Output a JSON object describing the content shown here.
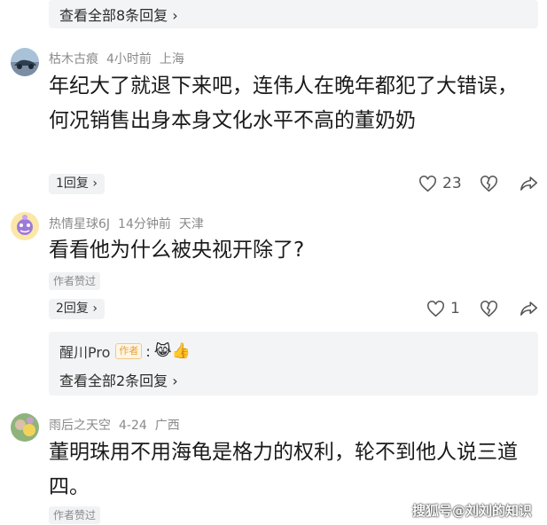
{
  "top_box": {
    "link": "查看全部8条回复 ›"
  },
  "comment1": {
    "user": "枯木古痕",
    "time": "4小时前",
    "location": "上海",
    "text": "年纪大了就退下来吧，连伟人在晚年都犯了大错误，何况销售出身本身文化水平不高的董奶奶",
    "reply_pill": "1回复 ›",
    "likes": "23"
  },
  "comment2": {
    "user": "热情星球6J",
    "time": "14分钟前",
    "location": "天津",
    "text": "看看他为什么被央视开除了?",
    "author_liked": "作者赞过",
    "reply_pill": "2回复 ›",
    "likes": "1",
    "sub_reply": {
      "user": "醒川Pro",
      "badge": "作者",
      "colon": ":",
      "emoji": "😹👍",
      "link": "查看全部2条回复 ›"
    }
  },
  "comment3": {
    "user": "雨后之天空",
    "time": "4-24",
    "location": "广西",
    "text": "董明珠用不用海龟是格力的权利，轮不到他人说三道四。",
    "author_liked": "作者赞过"
  },
  "watermark": "搜狐号@刘刘的知识",
  "colors": {
    "box_bg": "#f3f4f6",
    "meta": "#8a8a8a",
    "badge": "#e8a23a"
  }
}
